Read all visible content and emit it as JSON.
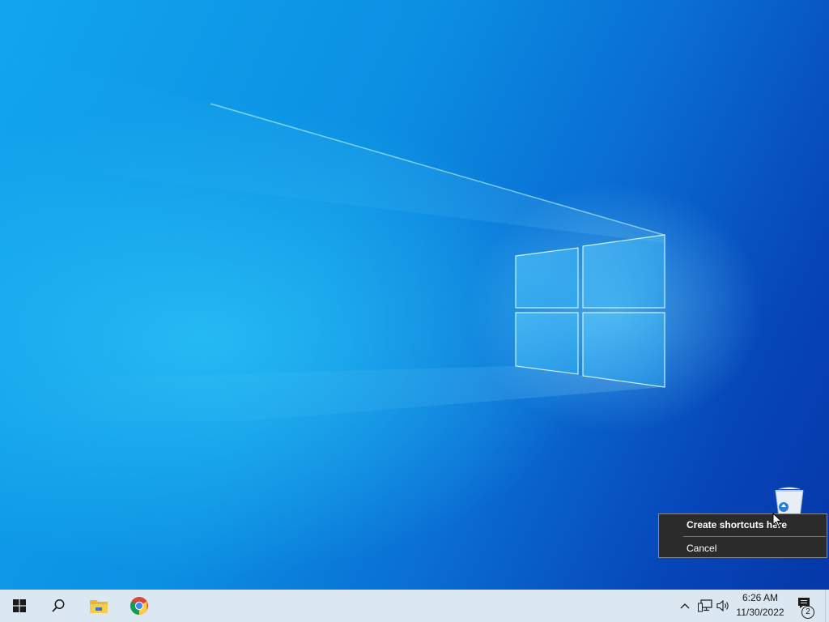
{
  "desktop": {
    "recycle_bin_icon": "recycle-bin-icon",
    "wallpaper": "windows-10-hero"
  },
  "context_menu": {
    "items": [
      {
        "label": "Create shortcuts here",
        "default": true
      },
      {
        "label": "Cancel",
        "default": false
      }
    ]
  },
  "taskbar": {
    "pinned": [
      {
        "name": "start",
        "icon": "windows-logo-icon"
      },
      {
        "name": "search",
        "icon": "search-icon"
      },
      {
        "name": "file-explorer",
        "icon": "folder-icon"
      },
      {
        "name": "chrome",
        "icon": "chrome-icon"
      }
    ],
    "tray": {
      "icons": [
        "chevron-up-icon",
        "network-icon",
        "volume-icon"
      ],
      "time": "6:26 AM",
      "date": "11/30/2022",
      "notification_count": "2"
    }
  },
  "colors": {
    "taskbar_bg": "#dbe7f1",
    "menu_bg": "#2b2b2b",
    "accent_blue": "#0a6fd4"
  }
}
